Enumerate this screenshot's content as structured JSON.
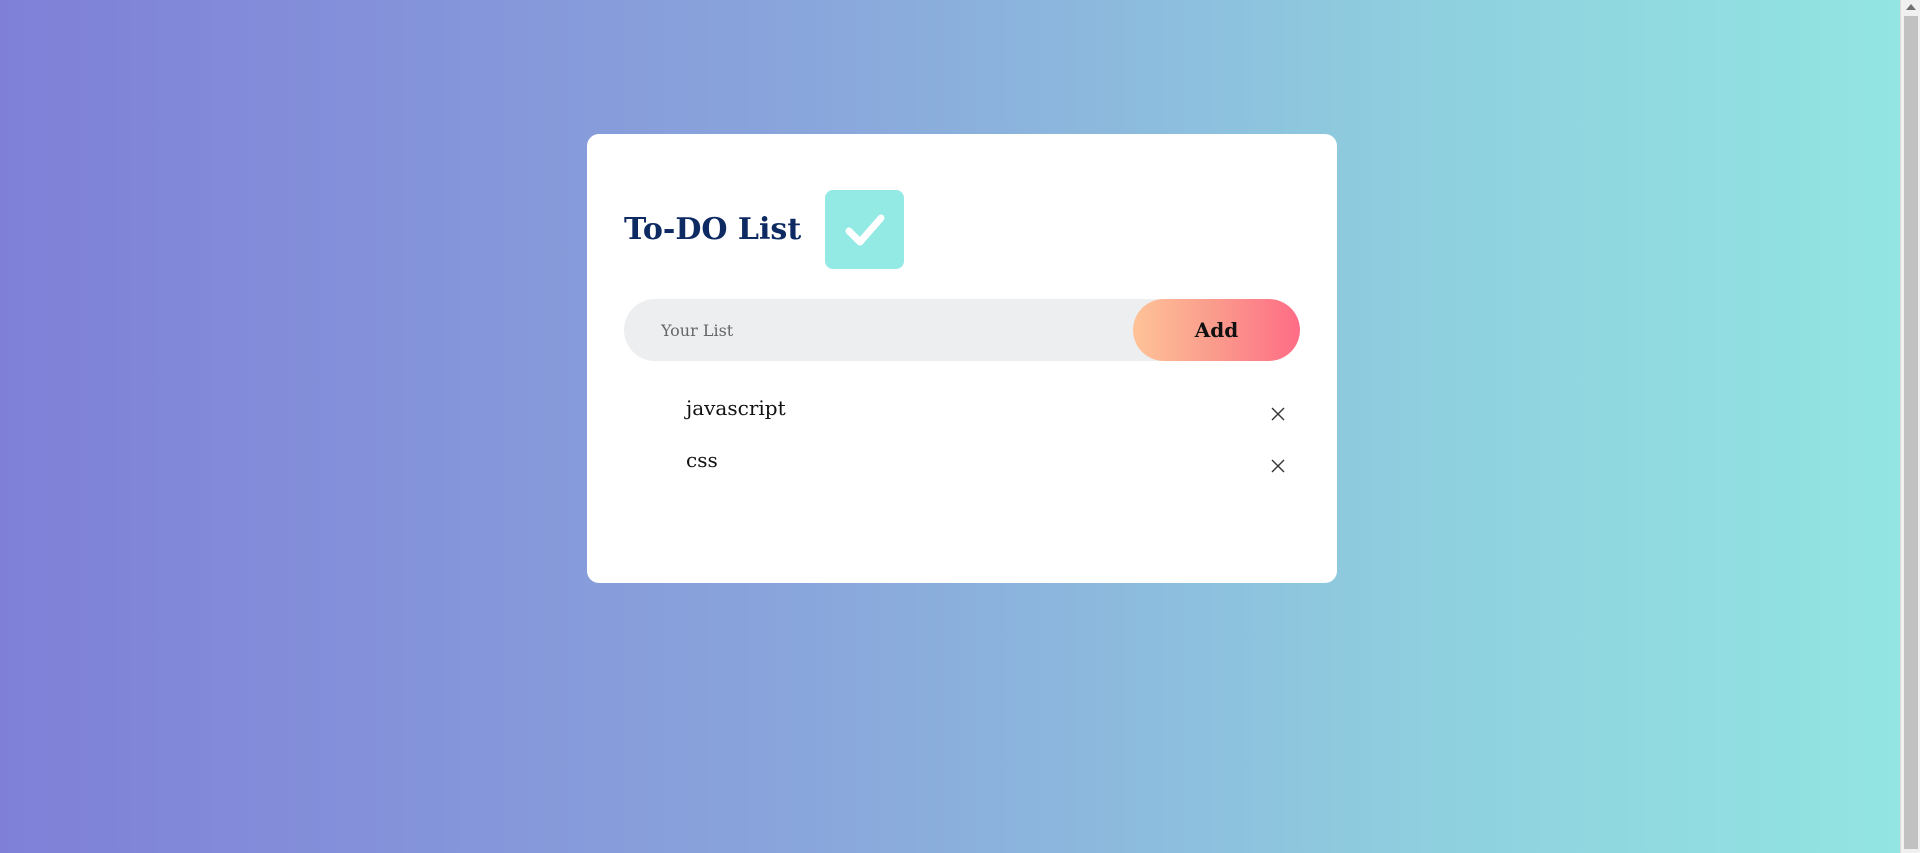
{
  "app": {
    "title": "To-DO List",
    "logo_icon": "check-icon"
  },
  "input": {
    "placeholder": "Your List",
    "value": ""
  },
  "add_button": {
    "label": "Add"
  },
  "tasks": [
    {
      "text": "javascript",
      "remove_icon": "close-icon"
    },
    {
      "text": "css",
      "remove_icon": "close-icon"
    }
  ],
  "colors": {
    "background_gradient": [
      "#7f7fd8",
      "#92e6e2"
    ],
    "title": "#0e2a62",
    "logo_bg": "#93e9e3",
    "input_bg": "#edeef0",
    "add_button_gradient": [
      "#ffc398",
      "#ff6c86"
    ]
  }
}
